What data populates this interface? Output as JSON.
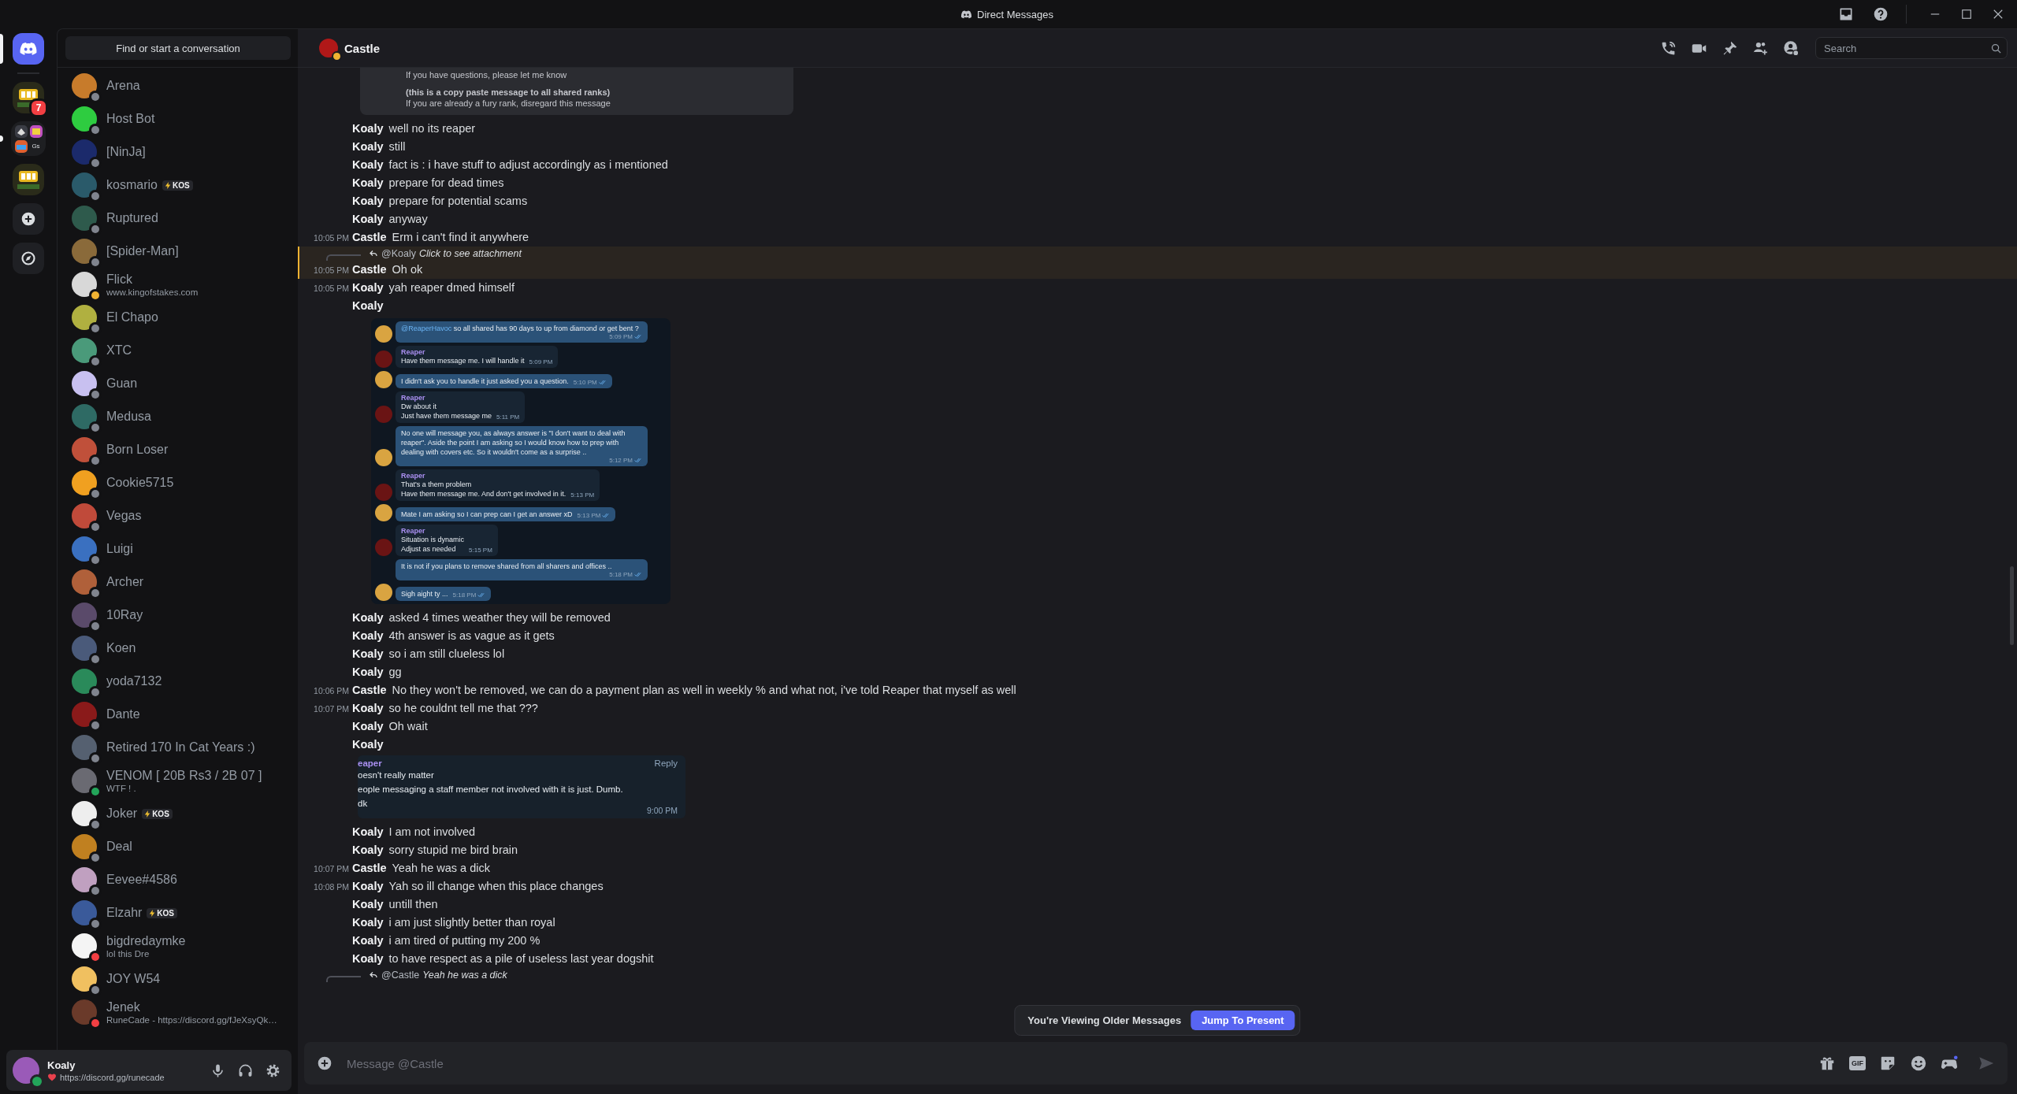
{
  "window": {
    "title": "Direct Messages"
  },
  "server_rail": [
    {
      "kind": "home",
      "selected": true,
      "unread": false
    },
    {
      "kind": "server",
      "selected": false,
      "unread": false,
      "badge": "7"
    },
    {
      "kind": "folder",
      "selected": false,
      "unread": true,
      "label": "Gs"
    },
    {
      "kind": "server",
      "selected": false,
      "unread": false
    },
    {
      "kind": "add",
      "selected": false,
      "unread": false
    },
    {
      "kind": "discover",
      "selected": false,
      "unread": false
    }
  ],
  "dm_search": {
    "label": "Find or start a conversation"
  },
  "direct_messages": [
    {
      "name": "Arena",
      "color": "#80848e"
    },
    {
      "name": "Host Bot",
      "color": "#80848e"
    },
    {
      "name": "[NinJa]",
      "color": "#80848e"
    },
    {
      "name": "kosmario",
      "color": "#80848e",
      "tag": "KOS"
    },
    {
      "name": "Ruptured",
      "color": "#80848e"
    },
    {
      "name": "[Spider-Man]",
      "color": "#80848e"
    },
    {
      "name": "Flick",
      "color": "#f0b232",
      "subtitle": "www.kingofstakes.com"
    },
    {
      "name": "El Chapo",
      "color": "#80848e"
    },
    {
      "name": "XTC",
      "color": "#80848e"
    },
    {
      "name": "Guan",
      "color": "#80848e"
    },
    {
      "name": "Medusa",
      "color": "#80848e"
    },
    {
      "name": "Born Loser",
      "color": "#80848e"
    },
    {
      "name": "Cookie5715",
      "color": "#80848e"
    },
    {
      "name": "Vegas",
      "color": "#80848e"
    },
    {
      "name": "Luigi",
      "color": "#80848e"
    },
    {
      "name": "Archer",
      "color": "#80848e"
    },
    {
      "name": "10Ray",
      "color": "#80848e"
    },
    {
      "name": "Koen",
      "color": "#80848e"
    },
    {
      "name": "yoda7132",
      "color": "#80848e"
    },
    {
      "name": "Dante",
      "color": "#80848e"
    },
    {
      "name": "Retired 170 In Cat Years :)",
      "color": "#80848e"
    },
    {
      "name": "VENOM [ 20B Rs3 / 2B 07 ]",
      "color": "#23a55a",
      "subtitle": "WTF ! ."
    },
    {
      "name": "Joker",
      "color": "#80848e",
      "tag": "KOS"
    },
    {
      "name": "Deal",
      "color": "#80848e"
    },
    {
      "name": "Eevee#4586",
      "color": "#80848e"
    },
    {
      "name": "Elzahr",
      "color": "#80848e",
      "tag": "KOS"
    },
    {
      "name": "bigdredaymke",
      "color": "#f23f43",
      "subtitle": "lol this Dre"
    },
    {
      "name": "JOY W54",
      "color": "#80848e"
    },
    {
      "name": "Jenek",
      "color": "#f23f43",
      "subtitle": "RuneCade - https://discord.gg/fJeXsyQk…"
    }
  ],
  "user_panel": {
    "name": "Koaly",
    "color": "#23a55a",
    "custom_status": "https://discord.gg/runecade"
  },
  "chat_header": {
    "name": "Castle",
    "color": "#f0b232",
    "search_placeholder": "Search"
  },
  "messages": [
    {
      "kind": "embed_tail",
      "highlighted": false,
      "lines": [
        {
          "text": "If you have questions, please let me know",
          "bold": false
        },
        {
          "text": "(this is a copy paste message to all shared ranks)",
          "bold": true
        },
        {
          "text": "If you are already a fury rank, disregard this message",
          "bold": false
        }
      ]
    },
    {
      "kind": "text",
      "highlighted": false,
      "author": "Koaly",
      "text": "well no its reaper"
    },
    {
      "kind": "text",
      "highlighted": false,
      "author": "Koaly",
      "text": "still"
    },
    {
      "kind": "text",
      "highlighted": false,
      "author": "Koaly",
      "text": "fact is : i have stuff to adjust accordingly as i mentioned"
    },
    {
      "kind": "text",
      "highlighted": false,
      "author": "Koaly",
      "text": "prepare for dead times"
    },
    {
      "kind": "text",
      "highlighted": false,
      "author": "Koaly",
      "text": "prepare for potential scams"
    },
    {
      "kind": "text",
      "highlighted": false,
      "author": "Koaly",
      "text": "anyway"
    },
    {
      "kind": "text",
      "highlighted": false,
      "time": "10:05 PM",
      "author": "Castle",
      "text": "Erm i can't find it anywhere"
    },
    {
      "kind": "text",
      "highlighted": true,
      "time": "10:05 PM",
      "author": "Castle",
      "text": "Oh ok",
      "reply": {
        "mention": "@Koaly",
        "text": "Click to see attachment"
      }
    },
    {
      "kind": "text",
      "highlighted": false,
      "time": "10:05 PM",
      "author": "Koaly",
      "text": "yah reaper dmed himself"
    },
    {
      "kind": "screenshot",
      "highlighted": false,
      "author": "Koaly",
      "bubbles": [
        {
          "kind": "outgoing",
          "avatar": true,
          "read": true,
          "mention": "@ReaperHavoc",
          "text": " so all shared has 90 days to up from diamond or get bent ?",
          "time": "5:09 PM"
        },
        {
          "kind": "incoming",
          "avatar": true,
          "read": false,
          "sender": "Reaper",
          "lines": [
            "Have them message me. I will handle it"
          ],
          "time": "5:09 PM"
        },
        {
          "kind": "outgoing",
          "avatar": true,
          "read": true,
          "text": "I didn't ask you to handle it just asked you a question.",
          "time": "5:10 PM"
        },
        {
          "kind": "incoming",
          "avatar": true,
          "read": false,
          "sender": "Reaper",
          "lines": [
            "Dw about it",
            "Just have them message me"
          ],
          "time": "5:11 PM"
        },
        {
          "kind": "outgoing",
          "avatar": true,
          "read": true,
          "text": "No one will message you, as always answer is \"I don't want to deal with reaper\". Aside the point I am asking so I would know how to prep with dealing with covers etc. So it wouldn't come as a surprise ..",
          "time": "5:12 PM"
        },
        {
          "kind": "incoming",
          "avatar": true,
          "read": false,
          "sender": "Reaper",
          "lines": [
            "That's a them problem",
            "Have them message me. And don't get involved in it."
          ],
          "time": "5:13 PM"
        },
        {
          "kind": "outgoing",
          "avatar": true,
          "read": true,
          "text": "Mate I am asking so I can prep can I get an answer xD",
          "time": "5:13 PM"
        },
        {
          "kind": "incoming",
          "avatar": true,
          "read": false,
          "sender": "Reaper",
          "lines": [
            "Situation is dynamic",
            "Adjust as needed"
          ],
          "time": "5:15 PM"
        },
        {
          "kind": "outgoing",
          "avatar": false,
          "read": true,
          "text": "It is not if you plans to remove shared from all sharers and offices ..",
          "time": "5:18 PM"
        },
        {
          "kind": "outgoing",
          "avatar": true,
          "read": true,
          "text": "Sigh aight ty ...",
          "time": "5:18 PM"
        }
      ]
    },
    {
      "kind": "text",
      "highlighted": false,
      "author": "Koaly",
      "text": "asked 4 times weather they will be removed"
    },
    {
      "kind": "text",
      "highlighted": false,
      "author": "Koaly",
      "text": "4th answer is as vague as it gets"
    },
    {
      "kind": "text",
      "highlighted": false,
      "author": "Koaly",
      "text": "so i am still clueless lol"
    },
    {
      "kind": "text",
      "highlighted": false,
      "author": "Koaly",
      "text": "gg"
    },
    {
      "kind": "text",
      "highlighted": false,
      "time": "10:06 PM",
      "author": "Castle",
      "text": "No they won't be removed, we can do a payment plan as well in weekly % and what not, i've told Reaper that myself as well"
    },
    {
      "kind": "text",
      "highlighted": false,
      "time": "10:07 PM",
      "author": "Koaly",
      "text": "so he couldnt tell me that ???"
    },
    {
      "kind": "text",
      "highlighted": false,
      "author": "Koaly",
      "text": "Oh wait"
    },
    {
      "kind": "quoted_image",
      "highlighted": false,
      "author": "Koaly",
      "quote": {
        "sender": "eaper",
        "action": "Reply",
        "lines": [
          "oesn't really matter",
          "eople messaging a staff member not involved with it is just. Dumb.",
          "dk"
        ],
        "time": "9:00 PM"
      }
    },
    {
      "kind": "text",
      "highlighted": false,
      "author": "Koaly",
      "text": "I am not involved"
    },
    {
      "kind": "text",
      "highlighted": false,
      "author": "Koaly",
      "text": "sorry stupid me bird brain"
    },
    {
      "kind": "text",
      "highlighted": false,
      "time": "10:07 PM",
      "author": "Castle",
      "text": "Yeah he was a dick"
    },
    {
      "kind": "text",
      "highlighted": false,
      "time": "10:08 PM",
      "author": "Koaly",
      "text": "Yah so ill change when this place changes"
    },
    {
      "kind": "text",
      "highlighted": false,
      "author": "Koaly",
      "text": "untill then"
    },
    {
      "kind": "text",
      "highlighted": false,
      "author": "Koaly",
      "text": "i am just slightly better than royal"
    },
    {
      "kind": "text",
      "highlighted": false,
      "author": "Koaly",
      "text": "i am tired of putting my 200 %"
    },
    {
      "kind": "text",
      "highlighted": false,
      "author": "Koaly",
      "text": "to have respect as a pile of useless last year dogshit"
    },
    {
      "kind": "reply_preview",
      "highlighted": false,
      "reply": {
        "mention": "@Castle",
        "text": "Yeah he was a dick"
      }
    }
  ],
  "older_messages_notice": {
    "text": "You're Viewing Older Messages",
    "button": "Jump To Present"
  },
  "composer": {
    "placeholder": "Message @Castle",
    "gif_label": "GIF"
  }
}
